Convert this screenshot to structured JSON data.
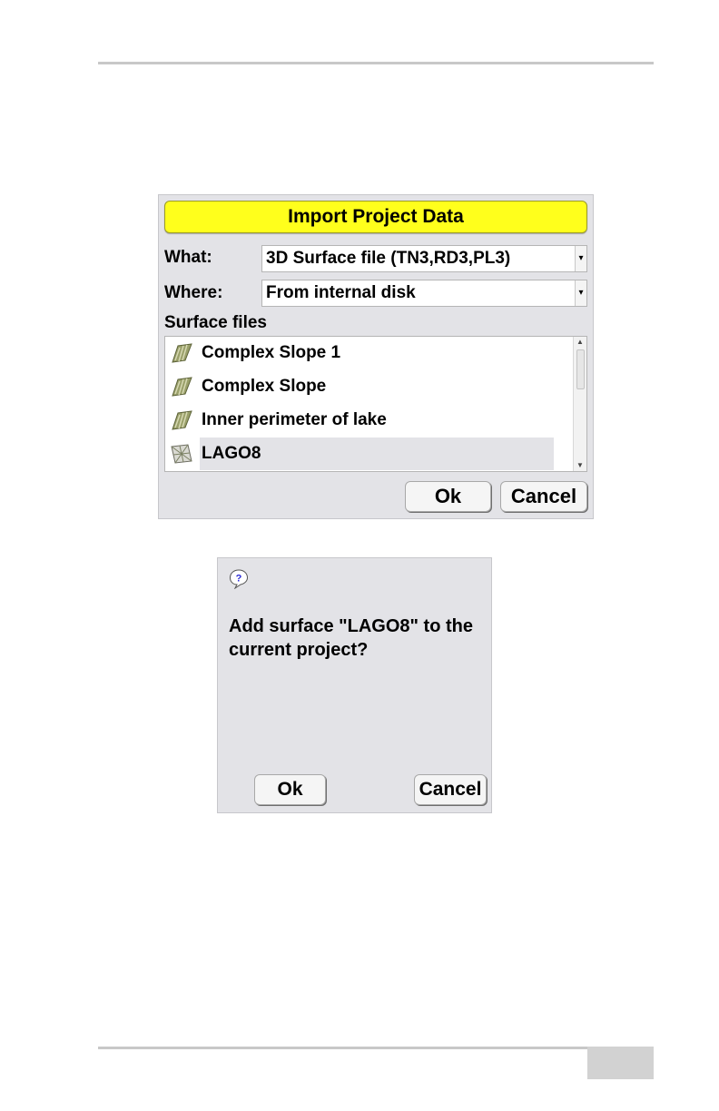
{
  "import_dialog": {
    "title": "Import Project Data",
    "what_label": "What:",
    "what_value": "3D Surface file (TN3,RD3,PL3)",
    "where_label": "Where:",
    "where_value": "From internal disk",
    "section_label": "Surface files",
    "files": [
      {
        "label": "Complex Slope 1",
        "icon": "slope-surface-icon",
        "selected": false
      },
      {
        "label": "Complex Slope",
        "icon": "slope-surface-icon",
        "selected": false
      },
      {
        "label": "Inner perimeter of lake",
        "icon": "slope-surface-icon",
        "selected": false
      },
      {
        "label": "LAGO8",
        "icon": "tin-surface-icon",
        "selected": true
      }
    ],
    "ok_label": "Ok",
    "cancel_label": "Cancel",
    "colors": {
      "title_bar": "#ffff1c",
      "dialog_bg": "#e3e3e7"
    }
  },
  "confirm_dialog": {
    "icon": "question-icon",
    "message": "Add surface \"LAGO8\" to the current project?",
    "ok_label": "Ok",
    "cancel_label": "Cancel"
  }
}
